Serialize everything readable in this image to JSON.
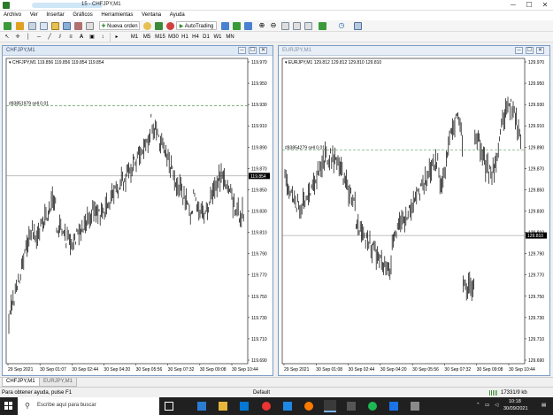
{
  "window": {
    "title": "15 - CHFJPY,M1",
    "minimize": "─",
    "maximize": "☐",
    "close": "✕"
  },
  "menu": [
    "Archivo",
    "Ver",
    "Insertar",
    "Gráficos",
    "Herramientas",
    "Ventana",
    "Ayuda"
  ],
  "toolbar": {
    "new_order": "Nueva orden",
    "autotrading": "AutoTrading",
    "timeframes": [
      "M1",
      "M5",
      "M15",
      "M30",
      "H1",
      "H4",
      "D1",
      "W1",
      "MN"
    ]
  },
  "charts": [
    {
      "caption": "CHFJPY,M1",
      "symbol_line": "CHFJPY,M1  119.856 119.856 119.854 119.854",
      "order_tag": "#83851979 sell 0.01",
      "price_tag": "119.854",
      "y_labels": [
        "119.970",
        "119.950",
        "119.930",
        "119.910",
        "119.890",
        "119.870",
        "119.850",
        "119.830",
        "119.810",
        "119.790",
        "119.770",
        "119.750",
        "119.730",
        "119.710",
        "119.690"
      ],
      "x_labels": [
        "29 Sep 2021",
        "30 Sep 01:07",
        "30 Sep 02:44",
        "30 Sep 04:20",
        "30 Sep 05:56",
        "30 Sep 07:32",
        "30 Sep 09:08",
        "30 Sep 10:44"
      ]
    },
    {
      "caption": "EURJPY,M1",
      "symbol_line": "EURJPY,M1  129.812 129.812 129.810 129.810",
      "order_tag": "#83854279 sell 0.01",
      "price_tag": "129.810",
      "y_labels": [
        "129.970",
        "129.950",
        "129.930",
        "129.910",
        "129.890",
        "129.870",
        "129.850",
        "129.830",
        "129.810",
        "129.790",
        "129.770",
        "129.750",
        "129.730",
        "129.710",
        "129.690"
      ],
      "x_labels": [
        "29 Sep 2021",
        "30 Sep 01:08",
        "30 Sep 02:44",
        "30 Sep 04:20",
        "30 Sep 05:56",
        "30 Sep 07:32",
        "30 Sep 09:08",
        "30 Sep 10:44"
      ]
    }
  ],
  "tabs": [
    "CHFJPY,M1",
    "EURJPY,M1"
  ],
  "status": {
    "help": "Para obtener ayuda, pulse F1",
    "profile": "Default",
    "traffic": "17331/9 kb"
  },
  "taskbar": {
    "search_placeholder": "Escribe aquí para buscar",
    "time": "10:18",
    "date": "30/09/2021"
  },
  "colors": {
    "chart_bg": "#ffffff",
    "grid": "#000000",
    "order_line": "#3c8c3c",
    "bid_line": "#808080",
    "taskbar": "#202020"
  }
}
